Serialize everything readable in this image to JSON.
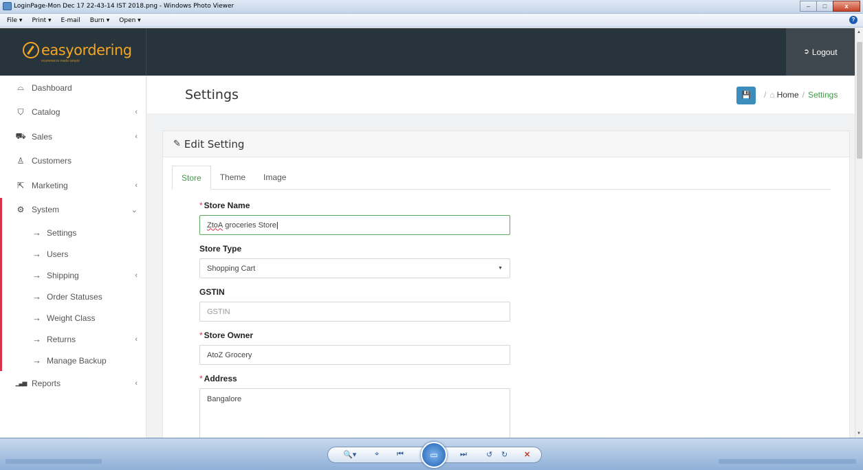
{
  "viewer": {
    "title": "LoginPage-Mon Dec 17 22-43-14 IST 2018.png - Windows Photo Viewer",
    "menu": [
      "File ▾",
      "Print ▾",
      "E-mail",
      "Burn ▾",
      "Open ▾"
    ],
    "help": "?",
    "win_min": "–",
    "win_max": "□",
    "win_close": "x"
  },
  "brand": {
    "name": "easyordering",
    "tagline": "ecommerce made simple"
  },
  "header": {
    "logout_label": "Logout"
  },
  "sidebar": {
    "items": [
      {
        "label": "Dashboard",
        "icon": "dashboard-icon",
        "glyph": "⌓"
      },
      {
        "label": "Catalog",
        "icon": "catalog-icon",
        "glyph": "⛉",
        "chevron": "‹"
      },
      {
        "label": "Sales",
        "icon": "cart-icon",
        "glyph": "⛟",
        "chevron": "‹"
      },
      {
        "label": "Customers",
        "icon": "user-icon",
        "glyph": "♙"
      },
      {
        "label": "Marketing",
        "icon": "share-icon",
        "glyph": "⇱",
        "chevron": "‹"
      },
      {
        "label": "System",
        "icon": "gear-icon",
        "glyph": "⚙",
        "chevron": "⌄"
      },
      {
        "label": "Reports",
        "icon": "bar-chart-icon",
        "glyph": "▁▃▅",
        "chevron": "‹"
      }
    ],
    "system_sub": [
      {
        "label": "Settings"
      },
      {
        "label": "Users"
      },
      {
        "label": "Shipping",
        "chevron": "‹"
      },
      {
        "label": "Order Statuses"
      },
      {
        "label": "Weight Class"
      },
      {
        "label": "Returns",
        "chevron": "‹"
      },
      {
        "label": "Manage Backup"
      }
    ]
  },
  "page": {
    "title": "Settings",
    "breadcrumb": {
      "home": "Home",
      "current": "Settings",
      "separator": "/"
    }
  },
  "panel": {
    "title": "Edit Setting",
    "tabs": [
      {
        "label": "Store"
      },
      {
        "label": "Theme"
      },
      {
        "label": "Image"
      }
    ]
  },
  "form": {
    "store_name": {
      "label": "Store Name",
      "value_misspelled": "ZtoA",
      "value_rest": " groceries Store"
    },
    "store_type": {
      "label": "Store Type",
      "value": "Shopping Cart"
    },
    "gstin": {
      "label": "GSTIN",
      "placeholder": "GSTIN"
    },
    "store_owner": {
      "label": "Store Owner",
      "value": "AtoZ Grocery"
    },
    "address": {
      "label": "Address",
      "value": "Bangalore"
    }
  },
  "colors": {
    "accent": "#3f9a4a",
    "brand": "#f5a623",
    "topbar": "#27343b",
    "danger": "#d9334b",
    "primary": "#3c8dbc"
  }
}
